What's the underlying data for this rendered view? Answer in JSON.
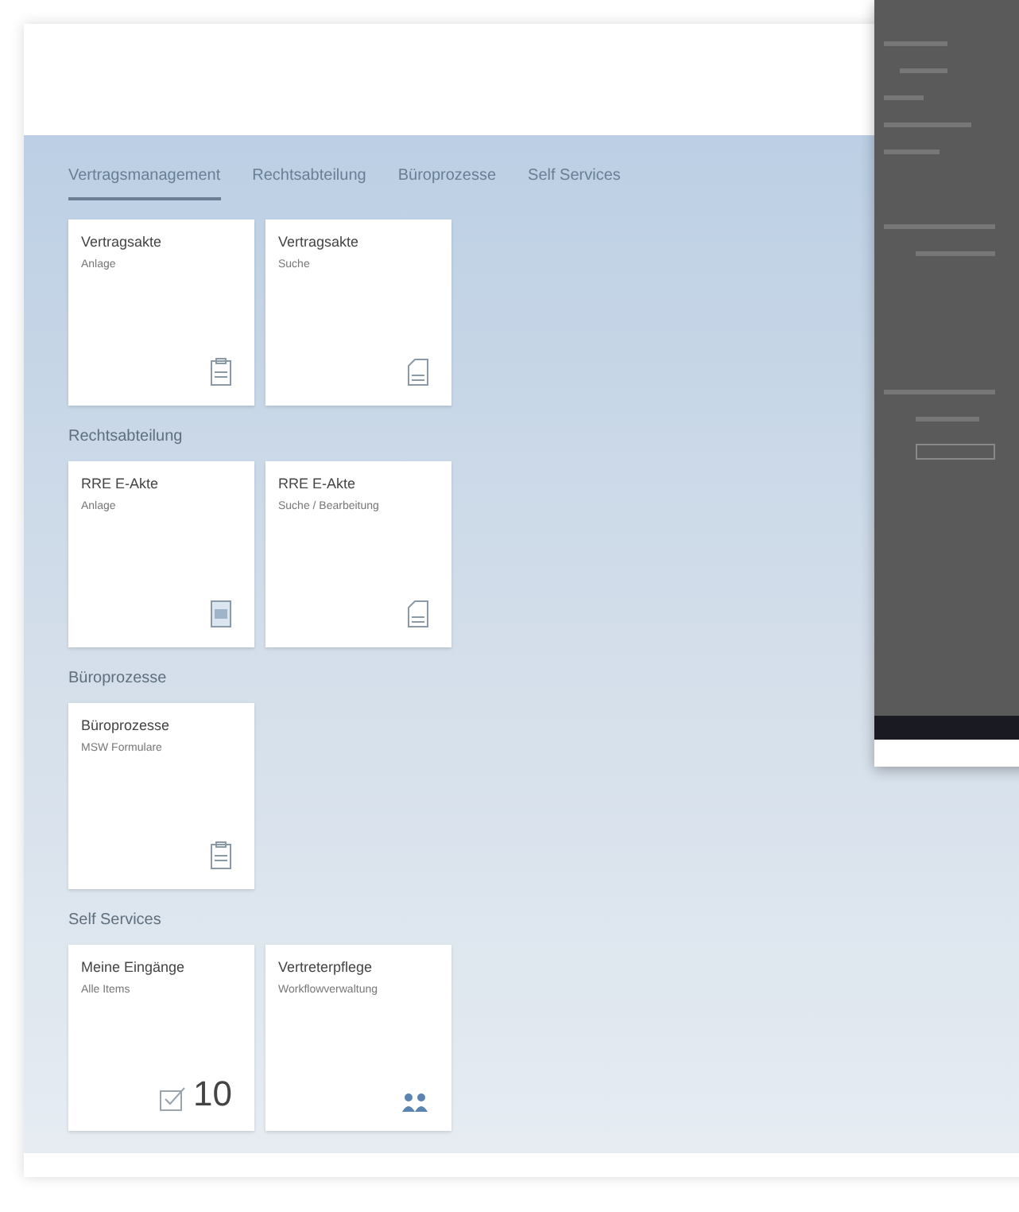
{
  "tabs": [
    {
      "label": "Vertragsmanagement",
      "selected": true
    },
    {
      "label": "Rechtsabteilung",
      "selected": false
    },
    {
      "label": "Büroprozesse",
      "selected": false
    },
    {
      "label": "Self Services",
      "selected": false
    }
  ],
  "groups": [
    {
      "tiles": [
        {
          "title": "Vertragsakte",
          "subtitle": "Anlage",
          "kind": "clipboard"
        },
        {
          "title": "Vertragsakte",
          "subtitle": "Suche",
          "kind": "document"
        }
      ]
    },
    {
      "title": "Rechtsabteilung",
      "tiles": [
        {
          "title": "RRE E-Akte",
          "subtitle": "Anlage",
          "kind": "form"
        },
        {
          "title": "RRE E-Akte",
          "subtitle": "Suche / Bearbeitung",
          "kind": "document"
        }
      ]
    },
    {
      "title": "Büroprozesse",
      "tiles": [
        {
          "title": "Büroprozesse",
          "subtitle": "MSW Formulare",
          "kind": "clipboard"
        }
      ]
    },
    {
      "title": "Self Services",
      "tiles": [
        {
          "title": "Meine Eingänge",
          "subtitle": "Alle Items",
          "kind": "count",
          "count": "10"
        },
        {
          "title": "Vertreterpflege",
          "subtitle": "Workflowverwaltung",
          "kind": "people"
        }
      ]
    }
  ]
}
